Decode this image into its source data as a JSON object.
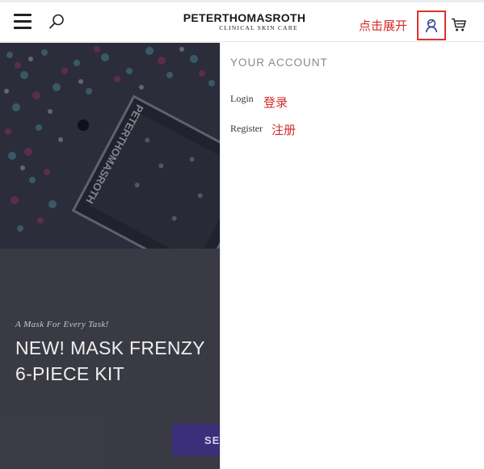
{
  "header": {
    "menu_icon": "hamburger-menu-icon",
    "search_icon": "search-icon",
    "logo": {
      "main": "PETERTHOMASROTH",
      "sub": "CLINICAL SKIN CARE"
    },
    "account_icon": "user-account-icon",
    "cart_icon": "shopping-cart-icon"
  },
  "annotations": {
    "expand": "点击展开",
    "login": "登录",
    "register": "注册",
    "color": "#d52a2a"
  },
  "hero": {
    "tagline": "A Mask For Every Task!",
    "title_line1": "NEW! MASK FRENZY",
    "title_line2": "6-PIECE KIT",
    "button_label": "SE"
  },
  "account_panel": {
    "title": "YOUR ACCOUNT",
    "links": [
      {
        "label": "Login"
      },
      {
        "label": "Register"
      }
    ]
  },
  "colors": {
    "accent_purple": "#3b2f7a",
    "highlight_red": "#e03030"
  }
}
